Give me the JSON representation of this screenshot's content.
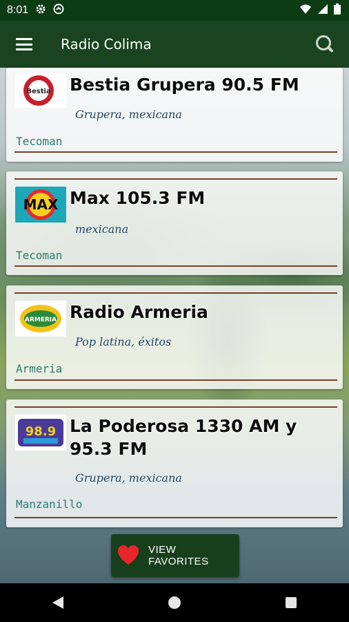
{
  "status_bar": {
    "time": "8:01",
    "left_icons": [
      "gear-icon",
      "sync-icon"
    ],
    "right_icons": [
      "wifi-icon",
      "signal-icon",
      "battery-icon"
    ]
  },
  "app_bar": {
    "title": "Radio Colima",
    "menu_icon": "hamburger-menu-icon",
    "search_icon": "search-icon",
    "background": "#1a4420"
  },
  "stations": [
    {
      "name": "Bestia Grupera 90.5 FM",
      "genre": "Grupera, mexicana",
      "city": "Tecoman",
      "logo_text": "Bestia"
    },
    {
      "name": "Max 105.3 FM",
      "genre": "mexicana",
      "city": "Tecoman",
      "logo_text": "MAX"
    },
    {
      "name": "Radio Armeria",
      "genre": "Pop latina, éxitos",
      "city": "Armeria",
      "logo_text": "ARMERIA"
    },
    {
      "name": "La Poderosa 1330 AM y 95.3 FM",
      "genre": "Grupera, mexicana",
      "city": "Manzanillo",
      "logo_text": "98.9"
    }
  ],
  "favorites_button": {
    "label": "VIEW FAVORITES",
    "icon": "heart-icon",
    "accent": "#e8262a"
  },
  "nav_bar": {
    "buttons": [
      "back-icon",
      "home-icon",
      "recents-icon"
    ]
  },
  "colors": {
    "divider": "#7a3f28",
    "city_text": "#2e7a70",
    "genre_text": "#1b3d5a"
  }
}
